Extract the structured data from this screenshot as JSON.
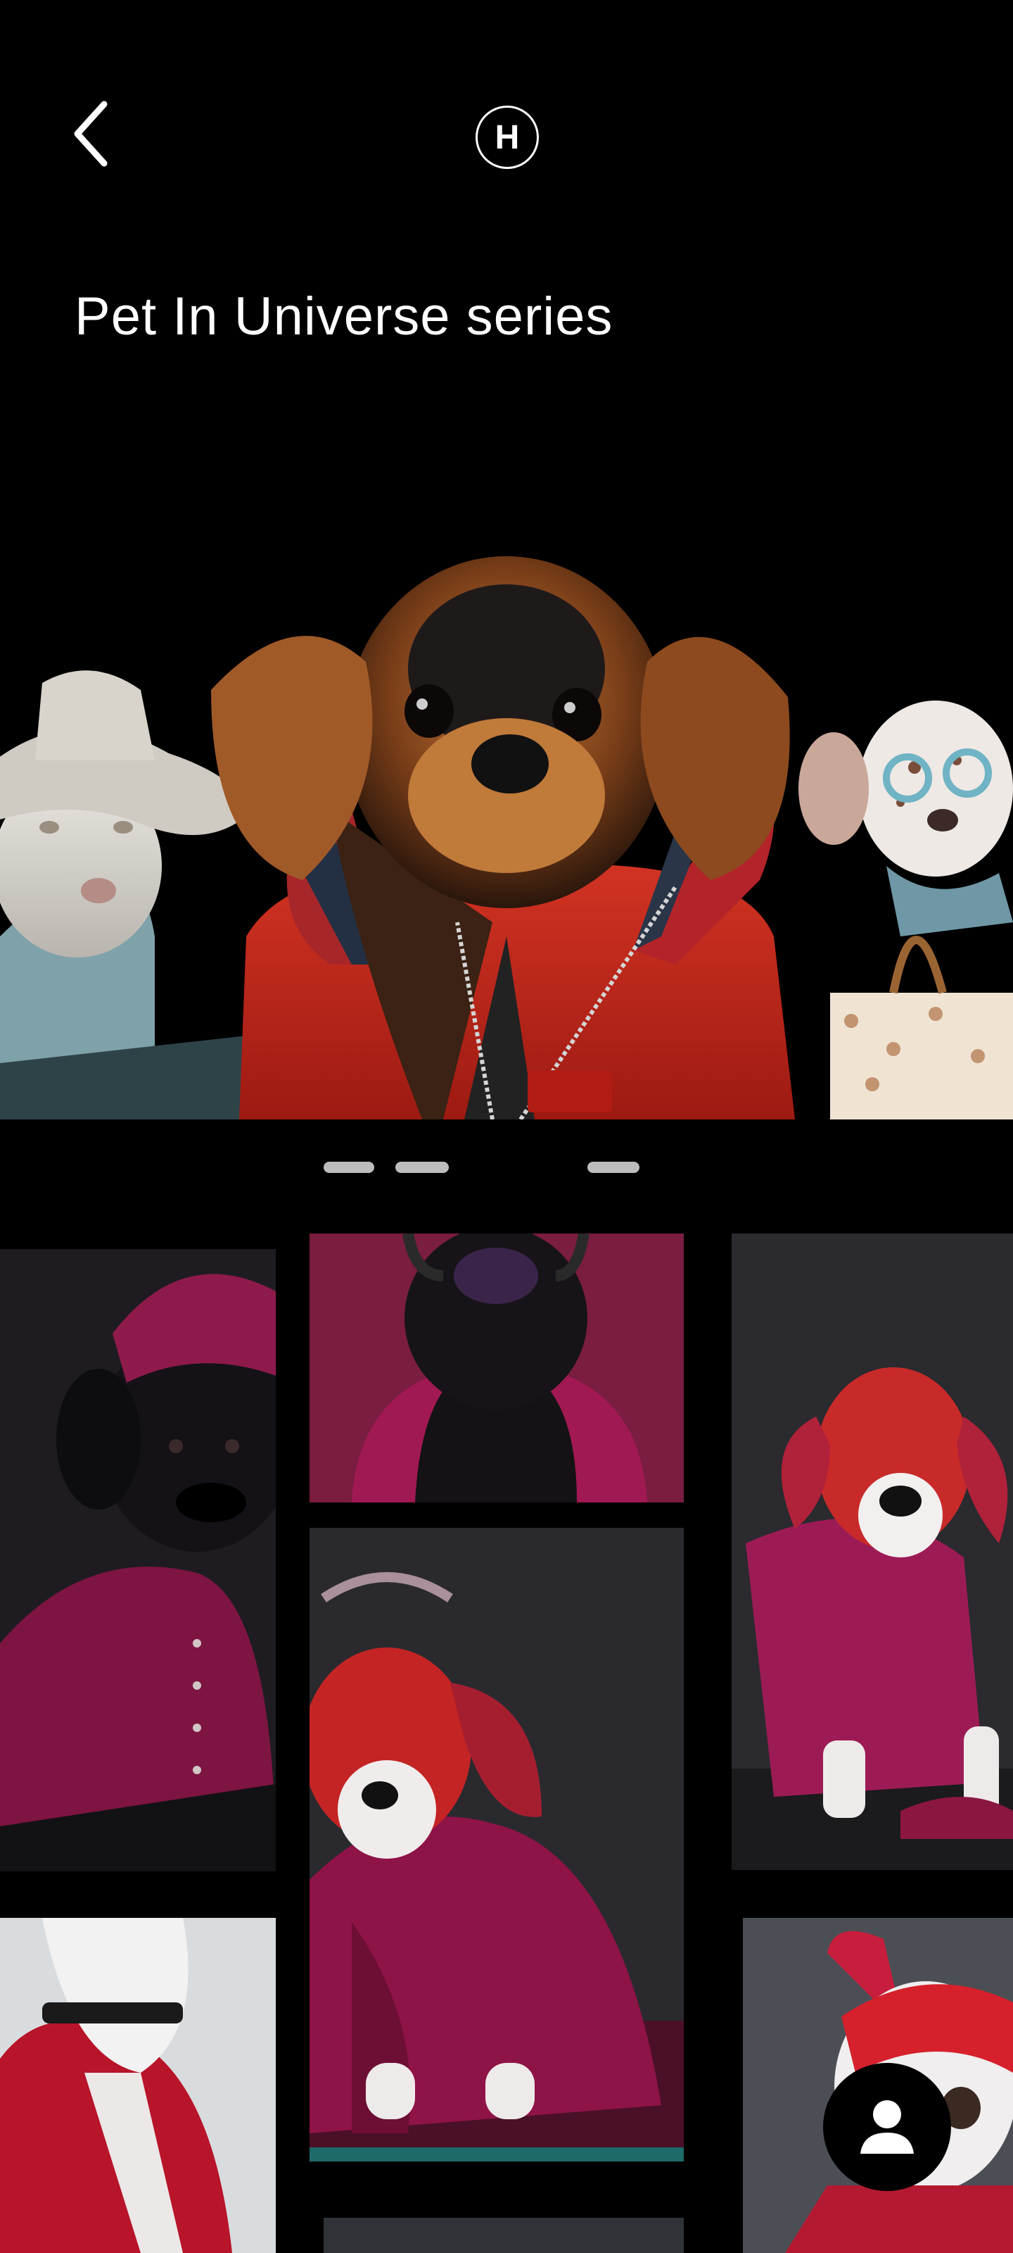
{
  "header": {
    "back_icon": "chevron-left-icon",
    "logo_letter": "H"
  },
  "page": {
    "title": "Pet In Universe series"
  },
  "hero": {
    "slides": [
      {
        "name": "white-dog-in-hat"
      },
      {
        "name": "dachshund-red-jacket"
      },
      {
        "name": "spotted-dog-sunglasses"
      }
    ],
    "active_index": 1
  },
  "gallery": {
    "items": [
      {
        "name": "black-bulldog-magenta-hat"
      },
      {
        "name": "black-dog-magenta-coat"
      },
      {
        "name": "beagle-magenta-suit"
      },
      {
        "name": "puppy-crown-magenta-cloak"
      },
      {
        "name": "white-dog-red-jacket"
      },
      {
        "name": "french-bulldog-red-hood"
      }
    ]
  },
  "fab": {
    "icon": "user-icon"
  },
  "colors": {
    "background": "#000000",
    "text": "#ffffff",
    "accent_magenta": "#a3174f",
    "accent_red": "#c7261f"
  }
}
